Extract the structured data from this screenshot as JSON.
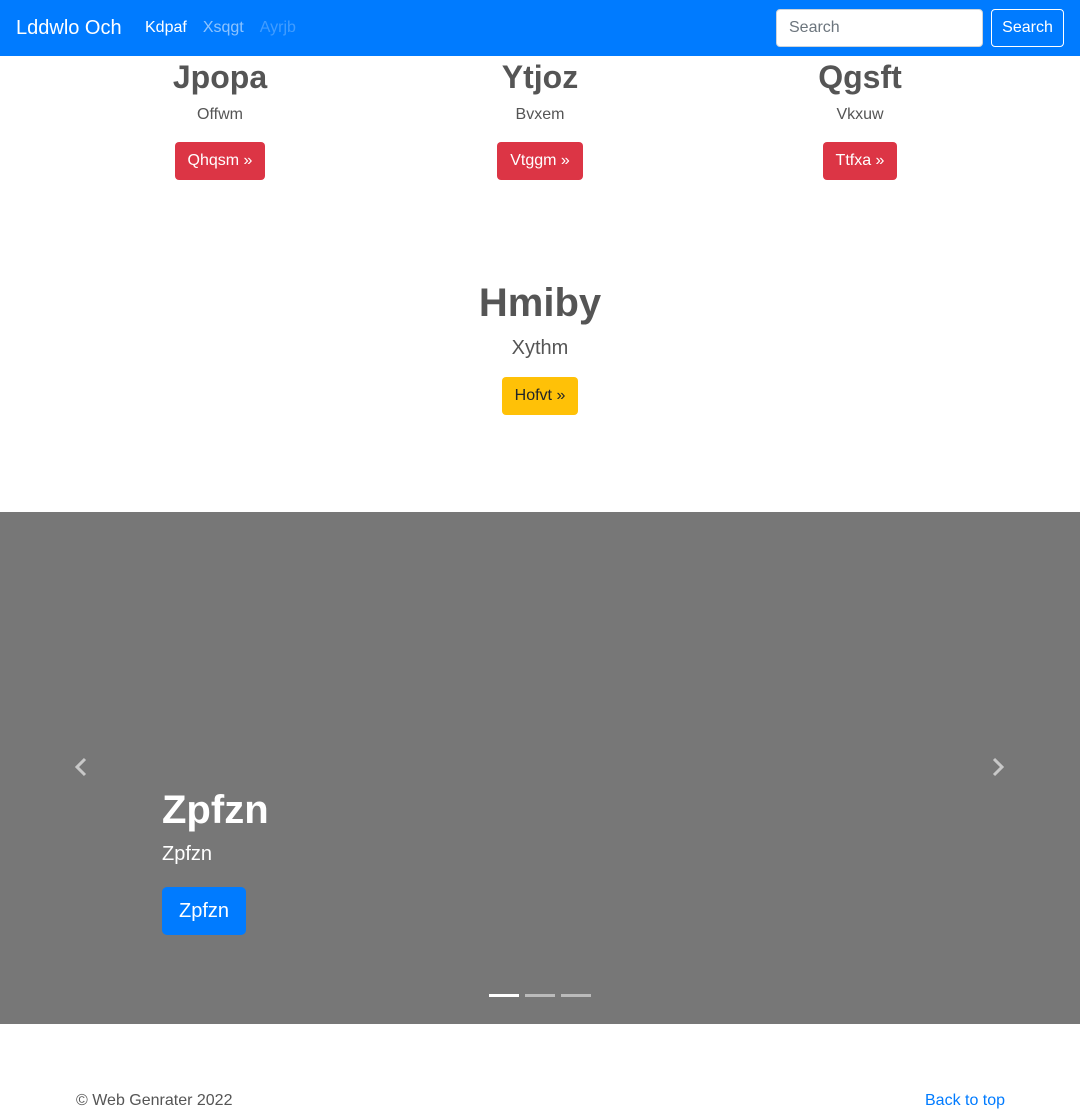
{
  "navbar": {
    "brand": "Lddwlo Och",
    "links": [
      {
        "label": "Kdpaf",
        "state": "active"
      },
      {
        "label": "Xsqgt",
        "state": "normal"
      },
      {
        "label": "Ayrjb",
        "state": "disabled"
      }
    ],
    "search_placeholder": "Search",
    "search_button": "Search"
  },
  "features": [
    {
      "title": "Jpopa",
      "text": "Offwm",
      "button": "Qhqsm »"
    },
    {
      "title": "Ytjoz",
      "text": "Bvxem",
      "button": "Vtggm »"
    },
    {
      "title": "Qgsft",
      "text": "Vkxuw",
      "button": "Ttfxa »"
    }
  ],
  "hero": {
    "title": "Hmiby",
    "lead": "Xythm",
    "button": "Hofvt »"
  },
  "carousel": {
    "title": "Zpfzn",
    "text": "Zpfzn",
    "button": "Zpfzn",
    "prev_icon": "chevron-left-icon",
    "next_icon": "chevron-right-icon",
    "slide_count": 3,
    "active_slide": 1
  },
  "footer": {
    "copyright": "© Web Genrater 2022",
    "back_to_top": "Back to top"
  },
  "colors": {
    "primary": "#007bff",
    "danger": "#dc3545",
    "warning": "#ffc107",
    "carousel_bg": "#777777"
  }
}
